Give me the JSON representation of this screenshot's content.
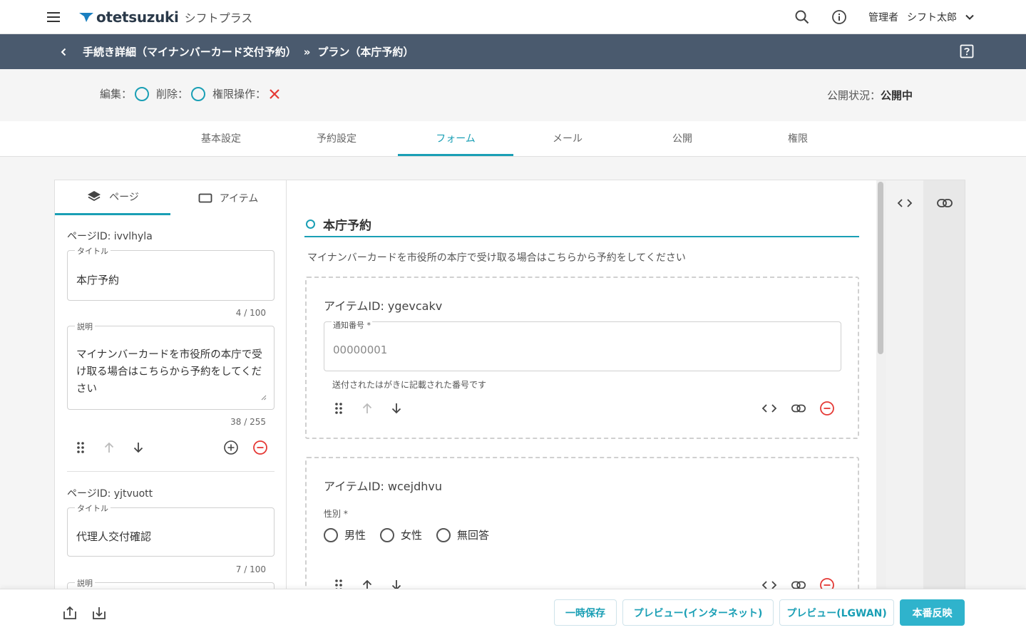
{
  "header": {
    "brand": "otetsuzuki",
    "product": "シフトプラス",
    "role": "管理者",
    "user_name": "シフト太郎"
  },
  "breadcrumb": {
    "parent": "手続き詳細（マイナンバーカード交付予約）",
    "separator": "»",
    "current": "プラン（本庁予約）"
  },
  "permissions": {
    "edit_label": "編集：",
    "delete_label": "削除：",
    "auth_label": "権限操作："
  },
  "publish": {
    "label": "公開状況：",
    "value": "公開中"
  },
  "tabs": [
    {
      "label": "基本設定"
    },
    {
      "label": "予約設定"
    },
    {
      "label": "フォーム"
    },
    {
      "label": "メール"
    },
    {
      "label": "公開"
    },
    {
      "label": "権限"
    }
  ],
  "left_tabs": {
    "page": "ページ",
    "item": "アイテム"
  },
  "pages": [
    {
      "id_label": "ページID: ivvlhyla",
      "title_label": "タイトル",
      "title_value": "本庁予約",
      "title_count": "4 / 100",
      "desc_label": "説明",
      "desc_value": "マイナンバーカードを市役所の本庁で受け取る場合はこちらから予約をしてください",
      "desc_count": "38 / 255"
    },
    {
      "id_label": "ページID: yjtvuott",
      "title_label": "タイトル",
      "title_value": "代理人交付確認",
      "title_count": "7 / 100",
      "desc_label": "説明"
    }
  ],
  "form": {
    "section_title": "本庁予約",
    "section_desc": "マイナンバーカードを市役所の本庁で受け取る場合はこちらから予約をしてください",
    "items": [
      {
        "id_label": "アイテムID: ygevcakv",
        "field_label": "通知番号 *",
        "field_value": "00000001",
        "hint": "送付されたはがきに記載された番号です"
      },
      {
        "id_label": "アイテムID: wcejdhvu",
        "field_label": "性別 *",
        "options": [
          "男性",
          "女性",
          "無回答"
        ]
      }
    ]
  },
  "footer": {
    "temp_save": "一時保存",
    "preview_internet": "プレビュー(インターネット)",
    "preview_lgwan": "プレビュー(LGWAN)",
    "publish": "本番反映"
  },
  "colors": {
    "accent": "#1a9fb5",
    "header_bar": "#4a5a6e",
    "danger": "#e53935",
    "primary_button": "#2fb3cc"
  }
}
